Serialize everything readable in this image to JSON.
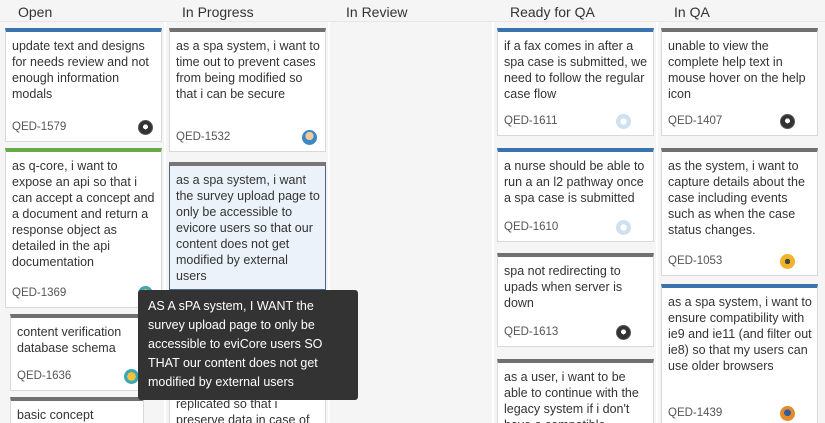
{
  "columns": [
    {
      "title": "Open"
    },
    {
      "title": "In Progress"
    },
    {
      "title": "In Review"
    },
    {
      "title": "Ready for QA"
    },
    {
      "title": "In QA"
    }
  ],
  "cards": {
    "open": [
      {
        "summary": "update text and designs for needs review and not enough information modals",
        "key": "QED-1579",
        "edge_color": "#3b73af",
        "avatar_icon": "bw-pattern-avatar-icon"
      },
      {
        "summary": "as q-core, i want to expose an api so that i can accept a concept and a document and return a response object as detailed in the api documentation",
        "key": "QED-1369",
        "edge_color": "#67ab49",
        "avatar_icon": "teal-avatar-icon"
      },
      {
        "summary": "content verification database schema",
        "key": "QED-1636",
        "edge_color": "#707070",
        "avatar_icon": "teal-avatar-icon"
      },
      {
        "summary": "basic concept",
        "key": "",
        "edge_color": "#707070",
        "avatar_icon": ""
      }
    ],
    "in_progress": [
      {
        "summary": "as a spa system, i want to time out to prevent cases from being modified so that i can be secure",
        "key": "QED-1532",
        "edge_color": "#707070",
        "avatar_icon": "face-avatar-icon"
      },
      {
        "summary": "as a spa system, i want the survey upload page to only be accessible to evicore users so that our content does not get modified by external users",
        "key": "",
        "edge_color": "#707070",
        "avatar_icon": ""
      },
      {
        "summary": "replicated so that i preserve data in case of",
        "key": "",
        "edge_color": "#707070",
        "avatar_icon": ""
      }
    ],
    "ready_for_qa": [
      {
        "summary": "if a fax comes in after a spa case is submitted, we need to follow the regular case flow",
        "key": "QED-1611",
        "edge_color": "#3b73af",
        "avatar_icon": "light-avatar-icon"
      },
      {
        "summary": "a nurse should be able to run a an l2 pathway once a spa case is submitted",
        "key": "QED-1610",
        "edge_color": "#3b73af",
        "avatar_icon": "light-avatar-icon"
      },
      {
        "summary": "spa not redirecting to upads when server is down",
        "key": "QED-1613",
        "edge_color": "#707070",
        "avatar_icon": "bw-pattern-avatar-icon"
      },
      {
        "summary": "as a user, i want to be able to continue with the legacy system if i don't have a compatible",
        "key": "",
        "edge_color": "#707070",
        "avatar_icon": ""
      }
    ],
    "in_qa": [
      {
        "summary": "unable to view the complete help text in mouse hover on the help icon",
        "key": "QED-1407",
        "edge_color": "#707070",
        "avatar_icon": "bw-pattern-avatar-icon"
      },
      {
        "summary": "as the system, i want to capture details about the case including events such as when the case status changes.",
        "key": "QED-1053",
        "edge_color": "#707070",
        "avatar_icon": "yellow-avatar-icon"
      },
      {
        "summary": "as a spa system, i want to ensure compatibility with ie9 and ie11 (and filter out ie8) so that my users can use older browsers",
        "key": "QED-1439",
        "edge_color": "#3b73af",
        "avatar_icon": "orange-avatar-icon"
      }
    ]
  },
  "tooltip": {
    "text": "AS A sPA system, I WANT the survey upload page to only be accessible to eviCore users SO THAT our content does not get modified by external users"
  }
}
